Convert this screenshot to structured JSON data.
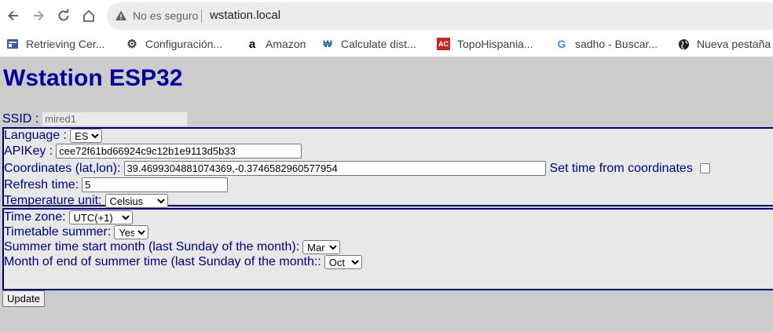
{
  "browser": {
    "insecure_label": "No es seguro",
    "url": "wstation.local"
  },
  "bookmarks": [
    {
      "label": "Retrieving Cer...",
      "icon": "document-icon",
      "color": "#3c5ba9"
    },
    {
      "label": "Configuración...",
      "icon": "gear-icon",
      "color": "#202124"
    },
    {
      "label": "Amazon",
      "icon": "amazon-icon",
      "color": "#000000"
    },
    {
      "label": "Calculate dist...",
      "icon": "calculator-logo-icon",
      "color": "#1a5c8a"
    },
    {
      "label": "TopoHispania...",
      "icon": "topohispania-icon",
      "color": "#c62828"
    },
    {
      "label": "sadho - Buscar...",
      "icon": "google-icon",
      "color": "#4285f4"
    },
    {
      "label": "Nueva pestaña",
      "icon": "globe-icon",
      "color": "#202124"
    }
  ],
  "page": {
    "title": "Wstation ESP32",
    "ssid_label": "SSID :",
    "ssid_value": "mired1",
    "language_label": "Language :",
    "language_value": "ES",
    "apikey_label": "APIKey :",
    "apikey_value": "cee72f61bd66924c9c12b1e9113d5b33",
    "coords_label": "Coordinates (lat,lon):",
    "coords_value": "39.4699304881074369,-0.3746582960577954",
    "set_time_label": "Set time from coordinates",
    "set_time_checked": false,
    "refresh_label": "Refresh time:",
    "refresh_value": "5",
    "temp_label": "Temperature unit:",
    "temp_value": "Celsius",
    "timezone_label": "Time zone:",
    "timezone_value": "UTC(+1)",
    "summer_label": "Timetable summer:",
    "summer_value": "Yes",
    "start_month_label": "Summer time start month (last Sunday of the month):",
    "start_month_value": "Mar",
    "end_month_label": "Month of end of summer time (last Sunday of the month::",
    "end_month_value": "Oct",
    "update_label": "Update"
  },
  "colors": {
    "title": "#000099",
    "label": "#000080",
    "fieldset_border": "#000070",
    "page_bg": "#cccccc",
    "fieldset_bg": "#e8e8e8"
  }
}
